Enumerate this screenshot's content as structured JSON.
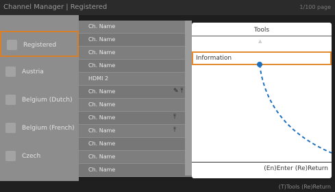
{
  "header": {
    "title": "Channel Manager | Registered",
    "page": "1/100 page"
  },
  "countries": [
    {
      "label": "Registered",
      "selected": true
    },
    {
      "label": "Austria",
      "selected": false
    },
    {
      "label": "Belgium (Dutch)",
      "selected": false
    },
    {
      "label": "Belgium (French)",
      "selected": false
    },
    {
      "label": "Czech",
      "selected": false
    }
  ],
  "country_more_icon": "down-arrow-icon",
  "channels": [
    {
      "name": "Ch. Name",
      "icons": ""
    },
    {
      "name": "Ch. Name",
      "icons": ""
    },
    {
      "name": "Ch. Name",
      "icons": ""
    },
    {
      "name": "Ch. Name",
      "icons": ""
    },
    {
      "name": "HDMI 2",
      "icons": ""
    },
    {
      "name": "Ch. Name",
      "icons": "✎ ⤒"
    },
    {
      "name": "Ch. Name",
      "icons": ""
    },
    {
      "name": "Ch. Name",
      "icons": "⤒"
    },
    {
      "name": "Ch. Name",
      "icons": "⤒"
    },
    {
      "name": "Ch. Name",
      "icons": ""
    },
    {
      "name": "Ch. Name",
      "icons": ""
    },
    {
      "name": "Ch. Name",
      "icons": ""
    }
  ],
  "tools_popup": {
    "title": "Tools",
    "menu_item": "Information",
    "nav_hint": "(En)Enter  (Re)Return",
    "accent_color": "#e38a2f",
    "connector_color": "#1f6fbf"
  },
  "footer": {
    "hint": "(T)Tools  (Re)Return"
  }
}
